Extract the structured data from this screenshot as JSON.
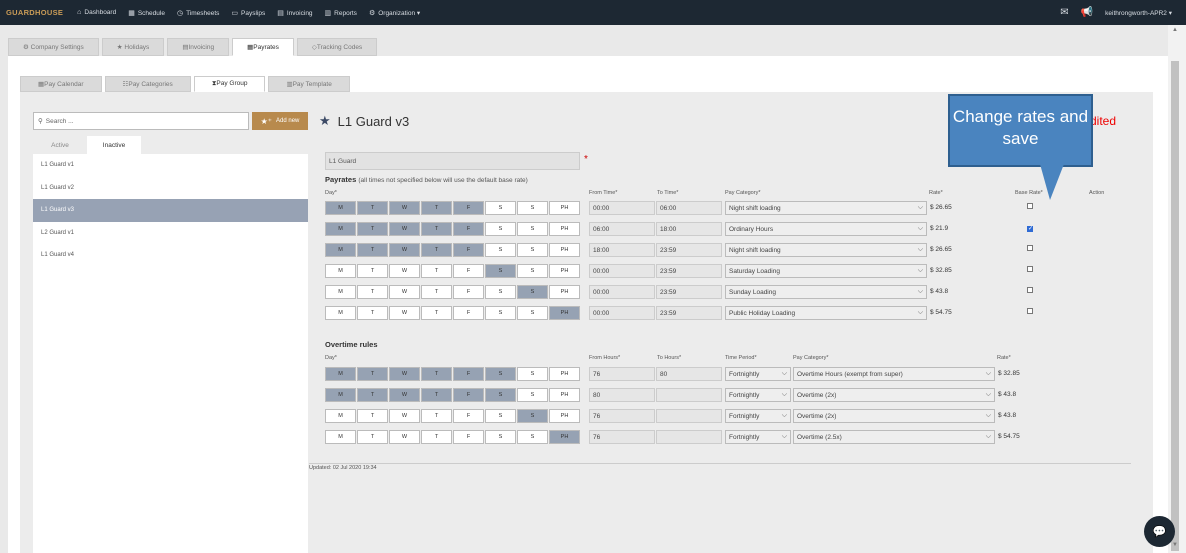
{
  "nav": {
    "brand": "GUARDHOUSE",
    "items": [
      {
        "icon": "⌂",
        "label": "Dashboard"
      },
      {
        "icon": "▦",
        "label": "Schedule"
      },
      {
        "icon": "◷",
        "label": "Timesheets"
      },
      {
        "icon": "▭",
        "label": "Payslips"
      },
      {
        "icon": "▤",
        "label": "Invoicing"
      },
      {
        "icon": "▥",
        "label": "Reports"
      },
      {
        "icon": "⚙",
        "label": "Organization ▾"
      }
    ],
    "user": "keithrongworth-APR2 ▾"
  },
  "tabs1": [
    "⚙ Company Settings",
    "★ Holidays",
    "▤Invoicing",
    "▦Payrates",
    "◇Tracking Codes"
  ],
  "tabs2": [
    "▦Pay Calendar",
    "☷Pay Categories",
    "⧗Pay Group",
    "▥Pay Template"
  ],
  "left": {
    "search_placeholder": "Search ...",
    "add_label": "Add new",
    "subtabs": [
      "Active",
      "Inactive"
    ],
    "list": [
      "L1 Guard v1",
      "L1 Guard v2",
      "L1 Guard v3",
      "L2 Guard v1",
      "L1 Guard v4"
    ]
  },
  "main": {
    "title": "L1 Guard v3",
    "edited": "dited",
    "callout": "Change rates and save",
    "name_value": "L1 Guard",
    "payrates_title": "Payrates",
    "payrates_note": "(all times not specified below will use the default base rate)",
    "pay_headers": {
      "day": "Day*",
      "from": "From Time*",
      "to": "To Time*",
      "cat": "Pay Category*",
      "rate": "Rate*",
      "base": "Base Rate*",
      "action": "Action"
    },
    "days": [
      "M",
      "T",
      "W",
      "T",
      "F",
      "S",
      "S",
      "PH"
    ],
    "payrates": [
      {
        "days": [
          1,
          1,
          1,
          1,
          1,
          0,
          0,
          0
        ],
        "from": "00:00",
        "to": "06:00",
        "category": "Night shift loading",
        "rate": "$ 26.65",
        "base": false
      },
      {
        "days": [
          1,
          1,
          1,
          1,
          1,
          0,
          0,
          0
        ],
        "from": "06:00",
        "to": "18:00",
        "category": "Ordinary Hours",
        "rate": "$ 21.9",
        "base": true
      },
      {
        "days": [
          1,
          1,
          1,
          1,
          1,
          0,
          0,
          0
        ],
        "from": "18:00",
        "to": "23:59",
        "category": "Night shift loading",
        "rate": "$ 26.65",
        "base": false
      },
      {
        "days": [
          0,
          0,
          0,
          0,
          0,
          1,
          0,
          0
        ],
        "from": "00:00",
        "to": "23:59",
        "category": "Saturday Loading",
        "rate": "$ 32.85",
        "base": false
      },
      {
        "days": [
          0,
          0,
          0,
          0,
          0,
          0,
          1,
          0
        ],
        "from": "00:00",
        "to": "23:59",
        "category": "Sunday Loading",
        "rate": "$ 43.8",
        "base": false
      },
      {
        "days": [
          0,
          0,
          0,
          0,
          0,
          0,
          0,
          1
        ],
        "from": "00:00",
        "to": "23:59",
        "category": "Public Holiday Loading",
        "rate": "$ 54.75",
        "base": false
      }
    ],
    "overtime_title": "Overtime rules",
    "ot_headers": {
      "day": "Day*",
      "from": "From Hours*",
      "to": "To Hours*",
      "period": "Time Period*",
      "cat": "Pay Category*",
      "rate": "Rate*"
    },
    "overtime": [
      {
        "days": [
          1,
          1,
          1,
          1,
          1,
          1,
          0,
          0
        ],
        "from": "76",
        "to": "80",
        "period": "Fortnightly",
        "category": "Overtime Hours (exempt from super)",
        "rate": "$ 32.85"
      },
      {
        "days": [
          1,
          1,
          1,
          1,
          1,
          1,
          0,
          0
        ],
        "from": "80",
        "to": "",
        "period": "Fortnightly",
        "category": "Overtime (2x)",
        "rate": "$ 43.8"
      },
      {
        "days": [
          0,
          0,
          0,
          0,
          0,
          0,
          1,
          0
        ],
        "from": "76",
        "to": "",
        "period": "Fortnightly",
        "category": "Overtime (2x)",
        "rate": "$ 43.8"
      },
      {
        "days": [
          0,
          0,
          0,
          0,
          0,
          0,
          0,
          1
        ],
        "from": "76",
        "to": "",
        "period": "Fortnightly",
        "category": "Overtime (2.5x)",
        "rate": "$ 54.75"
      }
    ],
    "updated": "Updated: 02 Jul 2020 19:34"
  }
}
